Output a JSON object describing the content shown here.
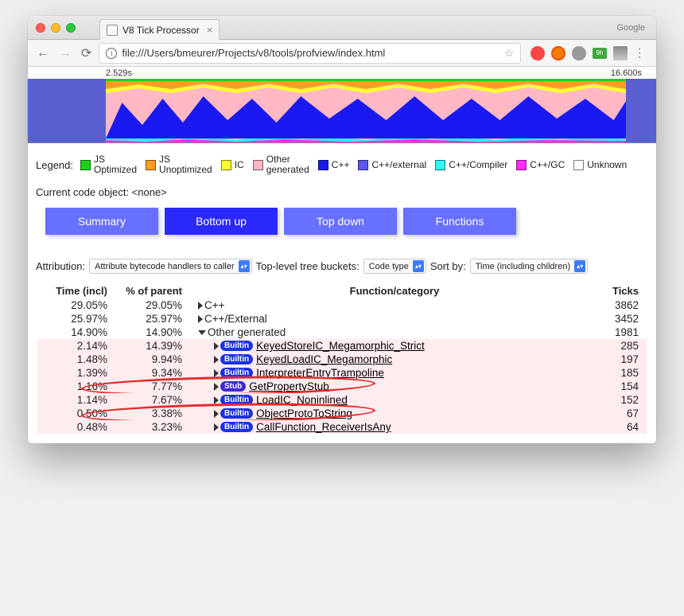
{
  "window": {
    "tab_title": "V8 Tick Processor",
    "brand": "Google",
    "url": "file:///Users/bmeurer/Projects/v8/tools/profview/index.html"
  },
  "ext_green": "9h",
  "timeline": {
    "start": "2.529s",
    "end": "16.600s"
  },
  "legend": {
    "label": "Legend:",
    "items": [
      {
        "color": "#1ed01e",
        "top": "JS",
        "bot": "Optimized"
      },
      {
        "color": "#ff9e22",
        "top": "JS",
        "bot": "Unoptimized"
      },
      {
        "color": "#ffff33",
        "top": "",
        "bot": "IC"
      },
      {
        "color": "#ffb8c4",
        "top": "Other",
        "bot": "generated"
      },
      {
        "color": "#1a1af0",
        "top": "",
        "bot": "C++"
      },
      {
        "color": "#5a56f2",
        "top": "",
        "bot": "C++/external"
      },
      {
        "color": "#2ff5f5",
        "top": "",
        "bot": "C++/Compiler"
      },
      {
        "color": "#ff2ef1",
        "top": "",
        "bot": "C++/GC"
      },
      {
        "color": "#ffffff",
        "top": "",
        "bot": "Unknown"
      }
    ]
  },
  "current_obj": "Current code object: <none>",
  "tabs": [
    "Summary",
    "Bottom up",
    "Top down",
    "Functions"
  ],
  "active_tab": 1,
  "filters": {
    "attr_label": "Attribution:",
    "attr_val": "Attribute bytecode handlers to caller",
    "bucket_label": "Top-level tree buckets:",
    "bucket_val": "Code type",
    "sort_label": "Sort by:",
    "sort_val": "Time (including children)"
  },
  "columns": {
    "time": "Time (incl)",
    "parent": "% of parent",
    "fn": "Function/category",
    "ticks": "Ticks"
  },
  "rows": [
    {
      "t": "29.05%",
      "p": "29.05%",
      "fn": "C++",
      "ticks": "3862",
      "ind": 1,
      "tri": "r",
      "shade": false
    },
    {
      "t": "25.97%",
      "p": "25.97%",
      "fn": "C++/External",
      "ticks": "3452",
      "ind": 1,
      "tri": "r",
      "shade": false
    },
    {
      "t": "14.90%",
      "p": "14.90%",
      "fn": "Other generated",
      "ticks": "1981",
      "ind": 1,
      "tri": "d",
      "shade": false
    },
    {
      "t": "2.14%",
      "p": "14.39%",
      "fn": "KeyedStoreIC_Megamorphic_Strict",
      "ticks": "285",
      "ind": 2,
      "tri": "r",
      "badge": "Builtin",
      "shade": true,
      "link": true
    },
    {
      "t": "1.48%",
      "p": "9.94%",
      "fn": "KeyedLoadIC_Megamorphic",
      "ticks": "197",
      "ind": 2,
      "tri": "r",
      "badge": "Builtin",
      "shade": true,
      "link": true
    },
    {
      "t": "1.39%",
      "p": "9.34%",
      "fn": "InterpreterEntryTrampoline",
      "ticks": "185",
      "ind": 2,
      "tri": "r",
      "badge": "Builtin",
      "shade": true,
      "link": true
    },
    {
      "t": "1.16%",
      "p": "7.77%",
      "fn": "GetPropertyStub",
      "ticks": "154",
      "ind": 2,
      "tri": "r",
      "badge": "Stub",
      "shade": true,
      "link": true,
      "annot": true
    },
    {
      "t": "1.14%",
      "p": "7.67%",
      "fn": "LoadIC_Noninlined",
      "ticks": "152",
      "ind": 2,
      "tri": "r",
      "badge": "Builtin",
      "shade": true,
      "link": true
    },
    {
      "t": "0.50%",
      "p": "3.38%",
      "fn": "ObjectProtoToString",
      "ticks": "67",
      "ind": 2,
      "tri": "r",
      "badge": "Builtin",
      "shade": true,
      "link": true,
      "annot": true
    },
    {
      "t": "0.48%",
      "p": "3.23%",
      "fn": "CallFunction_ReceiverIsAny",
      "ticks": "64",
      "ind": 2,
      "tri": "r",
      "badge": "Builtin",
      "shade": true,
      "link": true
    }
  ]
}
